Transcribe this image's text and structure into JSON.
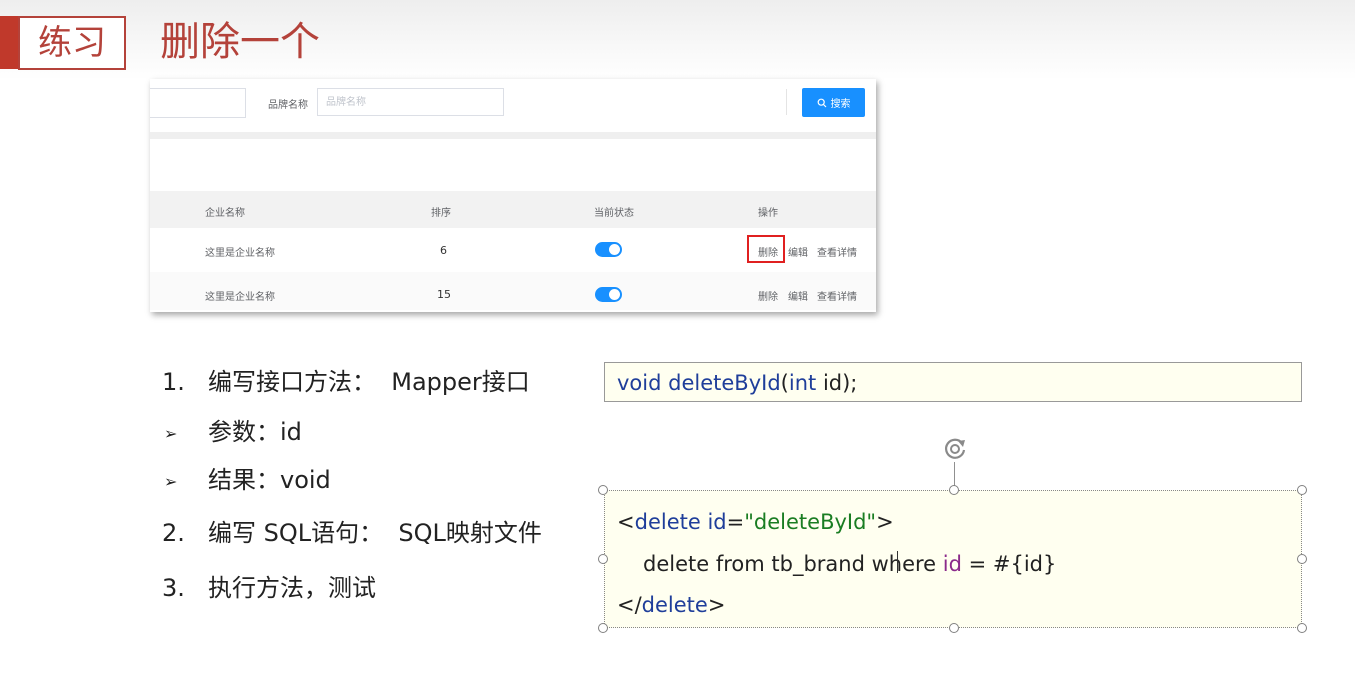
{
  "header": {
    "tag": "练习",
    "title": "删除一个"
  },
  "screenshot": {
    "brand_label": "品牌名称",
    "brand_placeholder": "品牌名称",
    "search_label": "搜索",
    "columns": [
      "企业名称",
      "排序",
      "当前状态",
      "操作"
    ],
    "rows": [
      {
        "company": "这里是企业名称",
        "order": "6",
        "status_on": true,
        "actions": [
          "删除",
          "编辑",
          "查看详情"
        ]
      },
      {
        "company": "这里是企业名称",
        "order": "15",
        "status_on": true,
        "actions": [
          "删除",
          "编辑",
          "查看详情"
        ]
      }
    ],
    "accent_color": "#1890ff",
    "highlight_color": "#e02020"
  },
  "steps": {
    "s1_num": "1.",
    "s1_text": "编写接口方法：  Mapper接口",
    "b1": "参数：id",
    "b2": "结果：void",
    "s2_num": "2.",
    "s2_text": "编写 SQL语句：  SQL映射文件",
    "s3_num": "3.",
    "s3_text": "执行方法，测试",
    "bullet_icon": "arrow-bullet-icon"
  },
  "code": {
    "interface": {
      "kw_void": "void",
      "name": "deleteById",
      "lparen": "(",
      "kw_int": "int",
      "rest": " id);"
    },
    "xml": {
      "l1_open": "<",
      "l1_tag": "delete",
      "l1_sp": " ",
      "l1_attr": "id",
      "l1_eq": "=",
      "l1_val": "\"deleteById\"",
      "l1_close": ">",
      "l2_a": "delete from tb_brand where ",
      "l2_id": "id",
      "l2_b": " = #{id}",
      "l3_open": "</",
      "l3_tag": "delete",
      "l3_close": ">"
    }
  }
}
